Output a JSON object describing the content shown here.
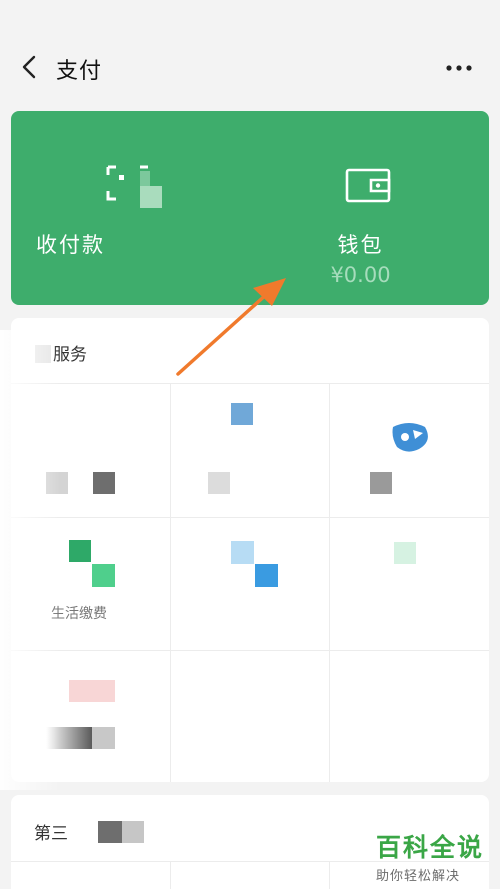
{
  "header": {
    "title": "支付",
    "back_icon": "chevron-left-icon",
    "more_icon": "more-horizontal-icon"
  },
  "pay_card": {
    "background": "#3ead6c",
    "collect": {
      "label": "收付款",
      "icon": "qr-scan-icon"
    },
    "wallet": {
      "label": "钱包",
      "amount": "¥0.00",
      "icon": "wallet-icon"
    }
  },
  "services": {
    "title": "服务",
    "tiles": [
      {
        "label": ""
      },
      {
        "label": ""
      },
      {
        "label": ""
      },
      {
        "label": "生活缴费"
      },
      {
        "label": ""
      },
      {
        "label": ""
      },
      {
        "label": ""
      }
    ]
  },
  "third_party": {
    "title": "第三"
  },
  "watermark": {
    "title": "百科全说",
    "subtitle": "助你轻松解决"
  },
  "colors": {
    "accent_green": "#3ead6c",
    "arrow": "#f07a2c",
    "watermark_green": "#3aa646"
  }
}
